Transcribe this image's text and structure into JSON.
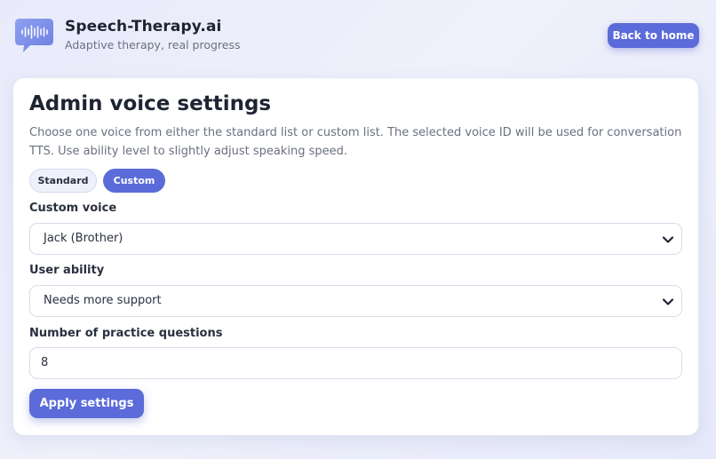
{
  "brand": {
    "logo_icon": "speech-bubble-waveform-icon",
    "title": "Speech-Therapy.ai",
    "tagline": "Adaptive therapy, real progress"
  },
  "header": {
    "back_label": "Back to home"
  },
  "settings": {
    "title": "Admin voice settings",
    "description": "Choose one voice from either the standard list or custom list. The selected voice ID will be used for conversation TTS. Use ability level to slightly adjust speaking speed.",
    "tabs": [
      {
        "label": "Standard",
        "active": false
      },
      {
        "label": "Custom",
        "active": true
      }
    ],
    "voice": {
      "label": "Custom voice",
      "value": "Jack (Brother)"
    },
    "ability": {
      "label": "User ability",
      "value": "Needs more support"
    },
    "questions": {
      "label": "Number of practice questions",
      "value": "8"
    },
    "apply_label": "Apply settings"
  },
  "colors": {
    "accent": "#5b6bd9",
    "background": "#eceefb",
    "text": "#1f2433",
    "muted": "#6a7080"
  }
}
